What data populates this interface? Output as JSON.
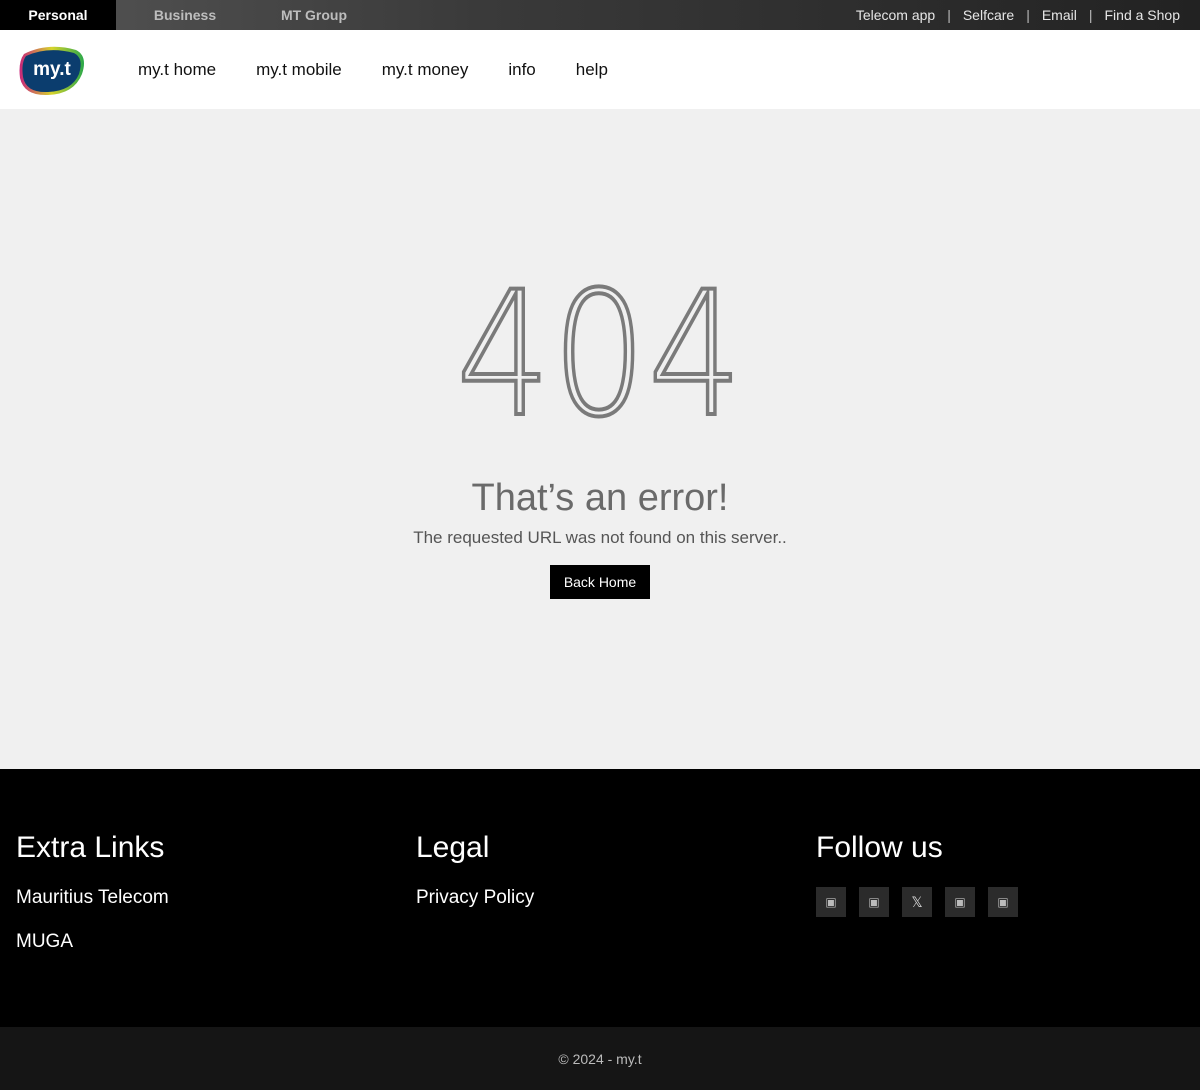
{
  "topbar": {
    "segments": [
      "Personal",
      "Business",
      "MT Group"
    ],
    "links": [
      "Telecom app",
      "Selfcare",
      "Email",
      "Find a Shop"
    ]
  },
  "header": {
    "logo_text": "my.t",
    "nav": [
      "my.t home",
      "my.t mobile",
      "my.t money",
      "info",
      "help"
    ]
  },
  "error": {
    "code": "404",
    "title": "That’s an error!",
    "message": "The requested URL was not found on this server..",
    "button": "Back Home"
  },
  "footer": {
    "extra_title": "Extra Links",
    "extra_links": [
      "Mauritius Telecom",
      "MUGA"
    ],
    "legal_title": "Legal",
    "legal_links": [
      "Privacy Policy"
    ],
    "follow_title": "Follow us",
    "socials": [
      "facebook-icon",
      "instagram-icon",
      "x-icon",
      "linkedin-icon",
      "youtube-icon"
    ],
    "copyright": "© 2024 - my.t"
  },
  "colors": {
    "logo_blue": "#0b3d6e",
    "logo_yellow": "#d6d42b",
    "logo_pink": "#c8247a",
    "button_bg": "#000000"
  }
}
